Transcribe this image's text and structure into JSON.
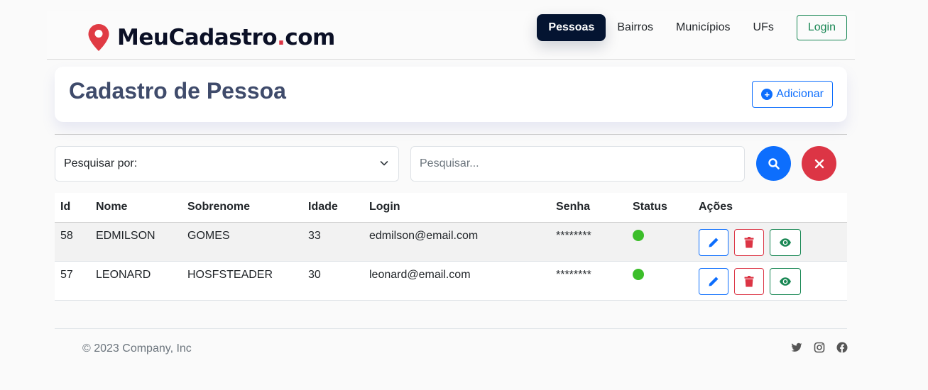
{
  "brand": {
    "name": "MeuCadastro",
    "dot": ".",
    "tld": "com"
  },
  "nav": {
    "items": [
      {
        "label": "Pessoas",
        "active": true
      },
      {
        "label": "Bairros",
        "active": false
      },
      {
        "label": "Municípios",
        "active": false
      },
      {
        "label": "UFs",
        "active": false
      }
    ],
    "login_label": "Login"
  },
  "page": {
    "title": "Cadastro de Pessoa",
    "add_label": "Adicionar"
  },
  "search": {
    "select_label": "Pesquisar por:",
    "placeholder": "Pesquisar..."
  },
  "table": {
    "headers": [
      "Id",
      "Nome",
      "Sobrenome",
      "Idade",
      "Login",
      "Senha",
      "Status",
      "Ações"
    ],
    "rows": [
      {
        "id": "58",
        "nome": "EDMILSON",
        "sobrenome": "GOMES",
        "idade": "33",
        "login": "edmilson@email.com",
        "senha": "********",
        "status": "active"
      },
      {
        "id": "57",
        "nome": "LEONARD",
        "sobrenome": "HOSFSTEADER",
        "idade": "30",
        "login": "leonard@email.com",
        "senha": "********",
        "status": "active"
      }
    ]
  },
  "footer": {
    "copyright": "© 2023 Company, Inc",
    "socials": [
      "twitter-icon",
      "instagram-icon",
      "facebook-icon"
    ]
  },
  "colors": {
    "primary": "#0d6efd",
    "danger": "#dc3545",
    "success": "#198754",
    "nav_active": "#041431",
    "status_active": "#3cbe2a"
  }
}
